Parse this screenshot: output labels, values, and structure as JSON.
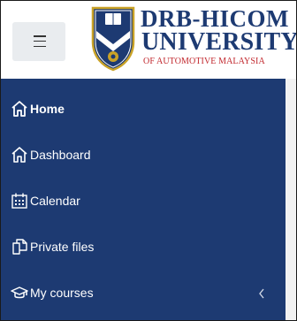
{
  "header": {
    "menu_button_icon": "hamburger-menu-icon",
    "logo": {
      "line1": "DRB-HICOM",
      "line2": "UNIVERSITY",
      "line3": "OF AUTOMOTIVE MALAYSIA",
      "crest_icon": "university-crest-icon"
    }
  },
  "nav": {
    "items": [
      {
        "label": "Home",
        "icon": "home-icon",
        "active": true
      },
      {
        "label": "Dashboard",
        "icon": "dashboard-home-icon",
        "active": false
      },
      {
        "label": "Calendar",
        "icon": "calendar-icon",
        "active": false
      },
      {
        "label": "Private files",
        "icon": "files-icon",
        "active": false
      },
      {
        "label": "My courses",
        "icon": "graduation-cap-icon",
        "active": false,
        "expand_icon": "chevron-left-icon"
      }
    ]
  },
  "colors": {
    "nav_background": "#1d3a72",
    "nav_text": "#ffffff",
    "brand_blue": "#1d3a72",
    "brand_red": "#c1272d",
    "menu_button_bg": "#e9ecef"
  }
}
